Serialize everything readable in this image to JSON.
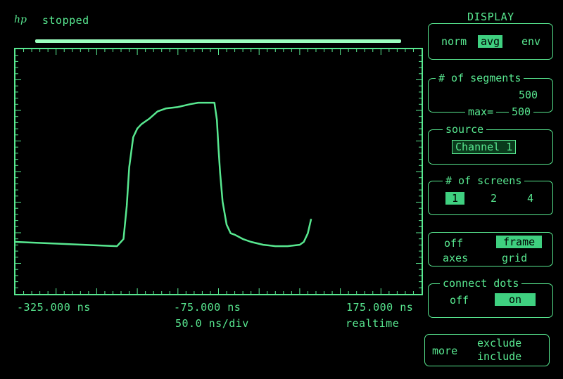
{
  "header": {
    "logo": "hp",
    "status": "stopped"
  },
  "panel": {
    "title": "DISPLAY",
    "mode": {
      "options": [
        "norm",
        "avg",
        "env"
      ],
      "selected": "avg"
    },
    "segments": {
      "label": "# of segments",
      "value": "500",
      "max_label": "max=",
      "max_value": "500"
    },
    "source": {
      "label": "source",
      "value": "Channel 1"
    },
    "screens": {
      "label": "# of screens",
      "options": [
        "1",
        "2",
        "4"
      ],
      "selected": "1"
    },
    "axes_grid": {
      "off": "off",
      "axes": "axes",
      "frame": "frame",
      "grid": "grid",
      "selected": "frame"
    },
    "connect_dots": {
      "label": "connect dots",
      "off": "off",
      "on": "on",
      "selected": "on"
    },
    "more": {
      "more": "more",
      "exclude": "exclude",
      "include": "include"
    }
  },
  "axis": {
    "left": "-325.000 ns",
    "center": "-75.000  ns",
    "right": "175.000 ns",
    "scale": "50.0 ns/div",
    "mode": "realtime"
  },
  "colors": {
    "trace": "#58e890",
    "background": "#000000",
    "highlight": "#3fd080"
  },
  "chart_data": {
    "type": "line",
    "xlim": [
      -325,
      175
    ],
    "x": [
      -325,
      -200,
      -192,
      -188,
      -185,
      -180,
      -175,
      -170,
      -165,
      -160,
      -150,
      -140,
      -125,
      -110,
      -100,
      -85,
      -80,
      -77,
      -75,
      -73,
      -70,
      -65,
      -60,
      -55,
      -45,
      -35,
      -20,
      -5,
      10,
      25,
      30,
      35,
      39
    ],
    "y": [
      0.0,
      -0.03,
      0.02,
      0.25,
      0.52,
      0.73,
      0.79,
      0.82,
      0.84,
      0.86,
      0.91,
      0.93,
      0.94,
      0.96,
      0.97,
      0.97,
      0.97,
      0.85,
      0.65,
      0.48,
      0.28,
      0.12,
      0.06,
      0.05,
      0.02,
      0.0,
      -0.02,
      -0.03,
      -0.03,
      -0.02,
      0.0,
      0.06,
      0.16
    ]
  }
}
